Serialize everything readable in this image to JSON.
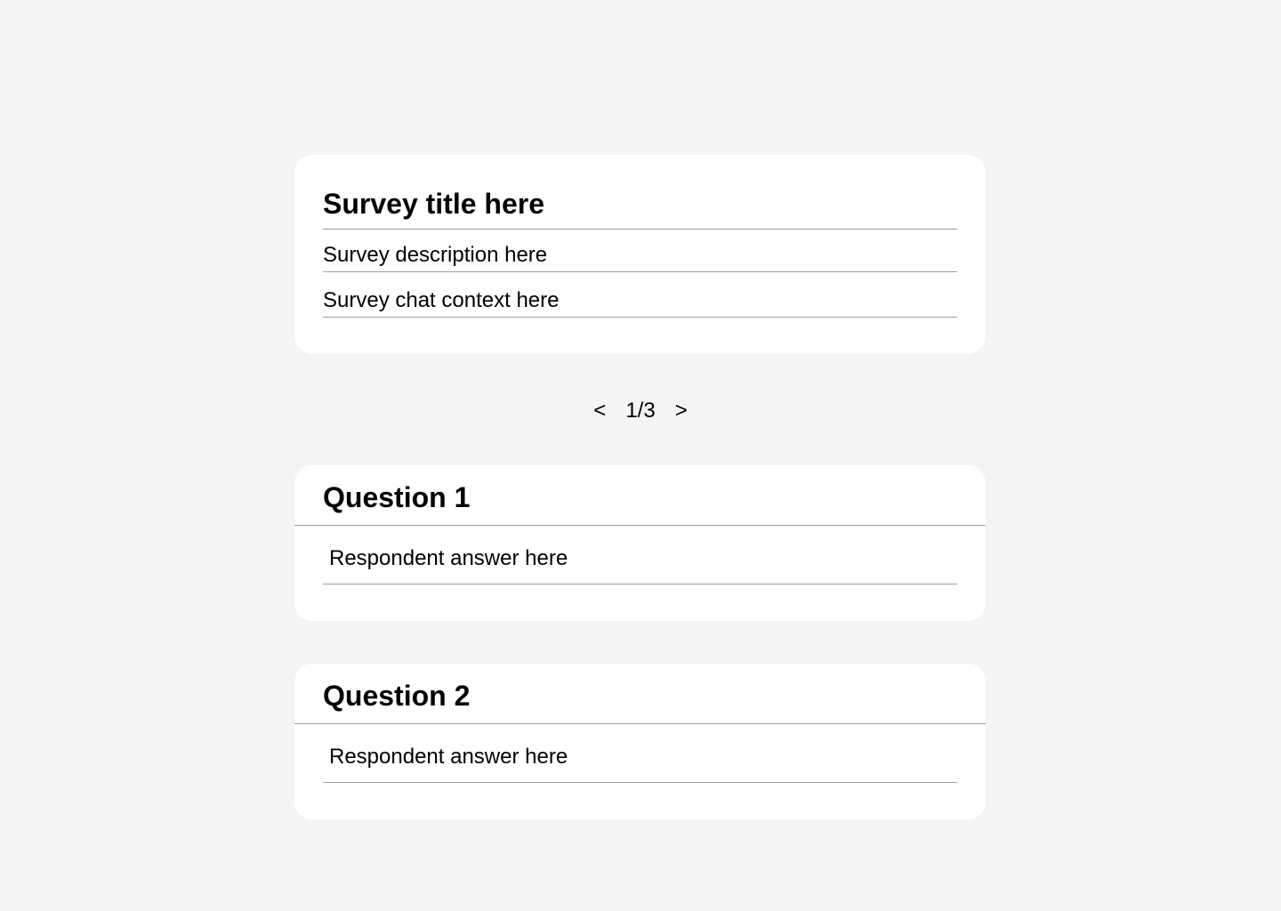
{
  "survey": {
    "title": "Survey title here",
    "description": "Survey description here",
    "chat_context": "Survey chat context here"
  },
  "pager": {
    "prev_label": "<",
    "count": "1/3",
    "next_label": ">"
  },
  "questions": [
    {
      "title": "Question 1",
      "answer": "Respondent answer here"
    },
    {
      "title": "Question 2",
      "answer": "Respondent answer here"
    }
  ],
  "colors": {
    "background": "#f4f4f4",
    "card": "#ffffff",
    "divider": "#9e9e9e",
    "text": "#000000"
  }
}
